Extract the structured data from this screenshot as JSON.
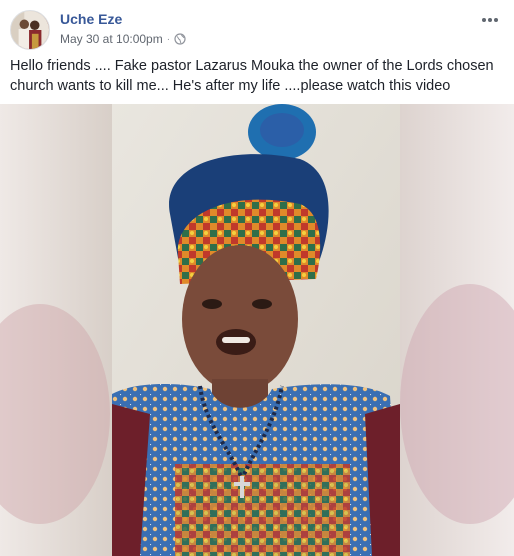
{
  "post": {
    "author": "Uche Eze",
    "timestamp": "May 30 at 10:00pm",
    "separator": "·",
    "privacy_icon": "globe-icon",
    "more_icon": "more-options-icon",
    "text": "Hello friends .... Fake pastor Lazarus Mouka the owner of the Lords chosen church wants to kill me... He's after my life ....please watch this video"
  },
  "colors": {
    "author_link": "#385898",
    "meta_text": "#616770",
    "body_text": "#1d2129"
  }
}
